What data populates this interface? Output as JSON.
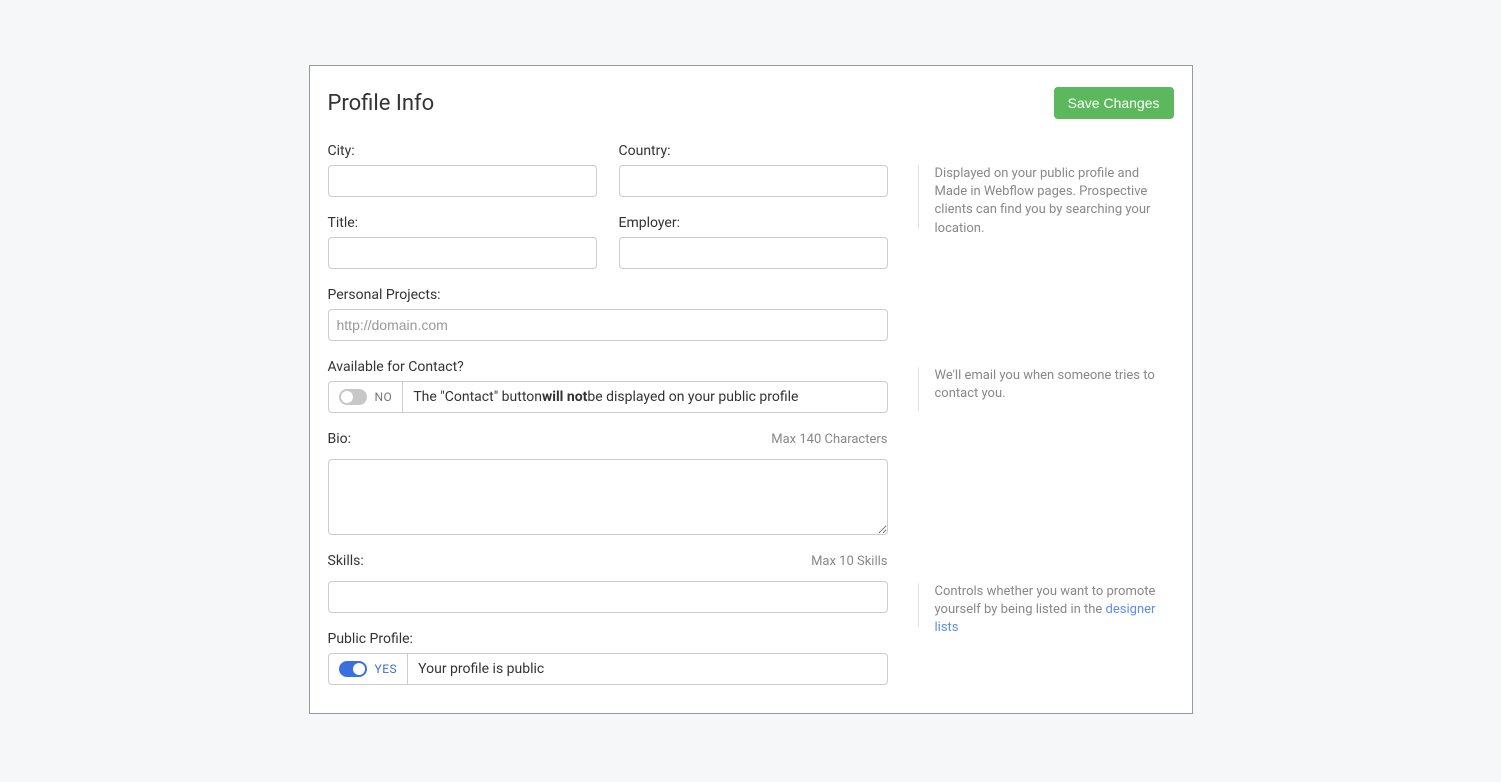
{
  "header": {
    "title": "Profile Info",
    "save_label": "Save Changes"
  },
  "fields": {
    "city": {
      "label": "City:",
      "value": ""
    },
    "country": {
      "label": "Country:",
      "value": ""
    },
    "title": {
      "label": "Title:",
      "value": ""
    },
    "employer": {
      "label": "Employer:",
      "value": ""
    },
    "projects": {
      "label": "Personal Projects:",
      "placeholder": "http://domain.com",
      "value": ""
    },
    "contact": {
      "label": "Available for Contact?",
      "enabled": false,
      "state_text": "NO",
      "desc_prefix": "The \"Contact\" button ",
      "desc_bold": "will not",
      "desc_suffix": " be displayed on your public profile"
    },
    "bio": {
      "label": "Bio:",
      "hint": "Max 140 Characters",
      "value": ""
    },
    "skills": {
      "label": "Skills:",
      "hint": "Max 10 Skills",
      "value": ""
    },
    "public": {
      "label": "Public Profile:",
      "enabled": true,
      "state_text": "YES",
      "desc": "Your profile is public"
    }
  },
  "help": {
    "city": "Displayed on your public profile and Made in Webflow pages. Prospective clients can find you by searching your location.",
    "contact": "We'll email you when someone tries to contact you.",
    "public_prefix": "Controls whether you want to promote yourself by being listed in the ",
    "public_link": "designer lists"
  }
}
